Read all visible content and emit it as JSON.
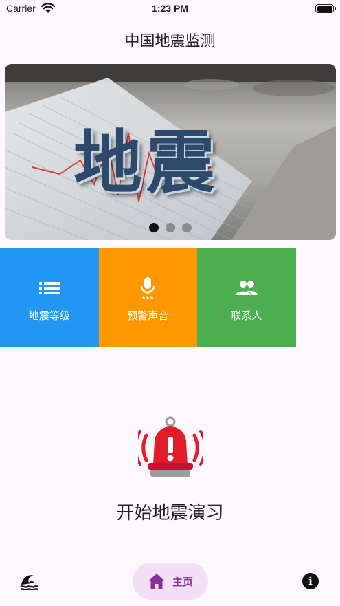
{
  "status_bar": {
    "carrier": "Carrier",
    "time": "1:23 PM",
    "wifi_icon": "wifi-icon",
    "battery_icon": "battery-icon"
  },
  "header": {
    "title": "中国地震监测"
  },
  "banner": {
    "image_text": "地震",
    "pages": 3,
    "active_page": 1
  },
  "tiles": [
    {
      "label": "地震等级",
      "icon": "list-icon",
      "color": "#2196f3"
    },
    {
      "label": "预警声音",
      "icon": "microphone-icon",
      "color": "#ff9800"
    },
    {
      "label": "联系人",
      "icon": "people-icon",
      "color": "#4caf50"
    }
  ],
  "drill": {
    "icon": "alarm-bell-icon",
    "label": "开始地震演习",
    "color": "#e11d2a"
  },
  "bottom_nav": {
    "left_icon": "tsunami-wave-icon",
    "home_icon": "home-icon",
    "home_label": "主页",
    "right_icon": "info-icon",
    "info_glyph": "i",
    "active_color": "#8a2e9a"
  }
}
